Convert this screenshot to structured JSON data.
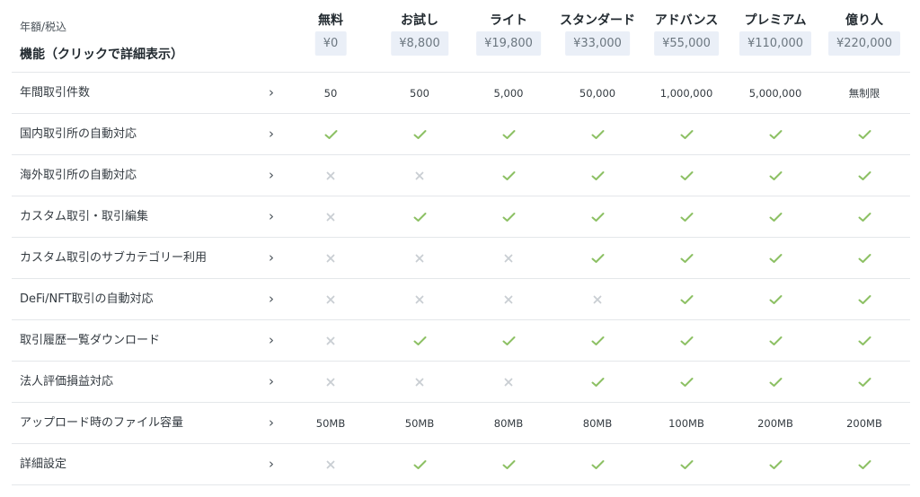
{
  "header": {
    "price_note": "年額/税込",
    "features_title": "機能（クリックで詳細表示）"
  },
  "plans": [
    {
      "name": "無料",
      "price": "¥0"
    },
    {
      "name": "お試し",
      "price": "¥8,800"
    },
    {
      "name": "ライト",
      "price": "¥19,800"
    },
    {
      "name": "スタンダード",
      "price": "¥33,000"
    },
    {
      "name": "アドバンス",
      "price": "¥55,000"
    },
    {
      "name": "プレミアム",
      "price": "¥110,000"
    },
    {
      "name": "億り人",
      "price": "¥220,000"
    }
  ],
  "colors": {
    "check": "#8cc063",
    "cross": "#c9ced3"
  },
  "rows": [
    {
      "label": "年間取引件数",
      "values": [
        "50",
        "500",
        "5,000",
        "50,000",
        "1,000,000",
        "5,000,000",
        "無制限"
      ]
    },
    {
      "label": "国内取引所の自動対応",
      "values": [
        "check",
        "check",
        "check",
        "check",
        "check",
        "check",
        "check"
      ]
    },
    {
      "label": "海外取引所の自動対応",
      "values": [
        "cross",
        "cross",
        "check",
        "check",
        "check",
        "check",
        "check"
      ]
    },
    {
      "label": "カスタム取引・取引編集",
      "values": [
        "cross",
        "check",
        "check",
        "check",
        "check",
        "check",
        "check"
      ]
    },
    {
      "label": "カスタム取引のサブカテゴリー利用",
      "values": [
        "cross",
        "cross",
        "cross",
        "check",
        "check",
        "check",
        "check"
      ]
    },
    {
      "label": "DeFi/NFT取引の自動対応",
      "values": [
        "cross",
        "cross",
        "cross",
        "cross",
        "check",
        "check",
        "check"
      ]
    },
    {
      "label": "取引履歴一覧ダウンロード",
      "values": [
        "cross",
        "check",
        "check",
        "check",
        "check",
        "check",
        "check"
      ]
    },
    {
      "label": "法人評価損益対応",
      "values": [
        "cross",
        "cross",
        "cross",
        "check",
        "check",
        "check",
        "check"
      ]
    },
    {
      "label": "アップロード時のファイル容量",
      "values": [
        "50MB",
        "50MB",
        "80MB",
        "80MB",
        "100MB",
        "200MB",
        "200MB"
      ]
    },
    {
      "label": "詳細設定",
      "values": [
        "cross",
        "check",
        "check",
        "check",
        "check",
        "check",
        "check"
      ]
    }
  ]
}
